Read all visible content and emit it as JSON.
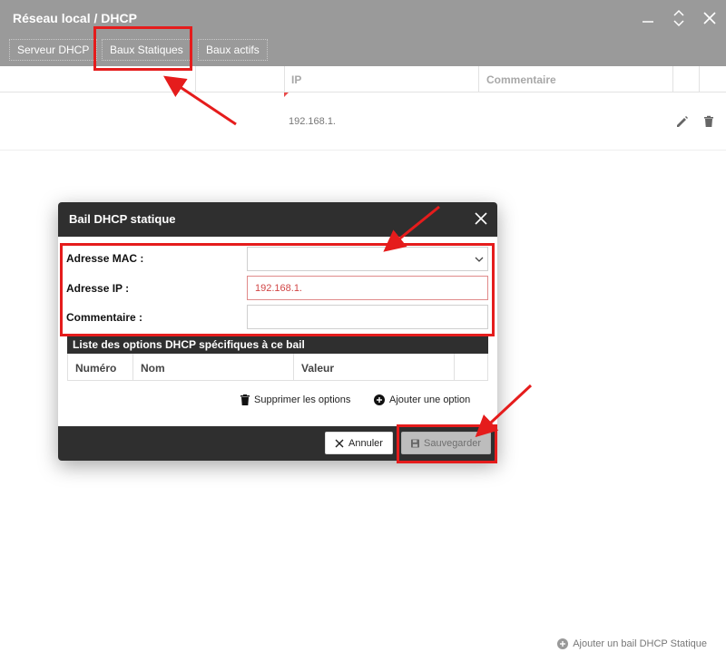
{
  "window": {
    "title": "Réseau local / DHCP",
    "controls": [
      "minimize-icon",
      "expand-icon",
      "close-icon"
    ]
  },
  "tabs": [
    {
      "label": "Serveur DHCP",
      "active": false
    },
    {
      "label": "Baux Statiques",
      "active": true
    },
    {
      "label": "Baux actifs",
      "active": false
    }
  ],
  "table": {
    "columns": [
      "",
      "",
      "IP",
      "Commentaire",
      "",
      ""
    ],
    "rows": [
      {
        "mac": "",
        "ip": "192.168.1.",
        "comment": "",
        "actions": [
          "edit-icon",
          "delete-icon"
        ]
      }
    ],
    "add_label": "Ajouter un bail DHCP Statique"
  },
  "modal": {
    "title": "Bail DHCP statique",
    "fields": {
      "mac": {
        "label": "Adresse MAC :",
        "value": ""
      },
      "ip": {
        "label": "Adresse IP :",
        "value": "192.168.1."
      },
      "comment": {
        "label": "Commentaire :",
        "value": ""
      }
    },
    "options": {
      "title": "Liste des options DHCP spécifiques à ce bail",
      "columns": [
        "Numéro",
        "Nom",
        "Valeur"
      ],
      "delete_label": "Supprimer les options",
      "add_label": "Ajouter une option"
    },
    "buttons": {
      "cancel": "Annuler",
      "save": "Sauvegarder"
    }
  },
  "colors": {
    "titlebar": "#9a9a9a",
    "modal_dark": "#2f2f2f",
    "annotation": "#e51c1c",
    "error_text": "#d14545"
  }
}
